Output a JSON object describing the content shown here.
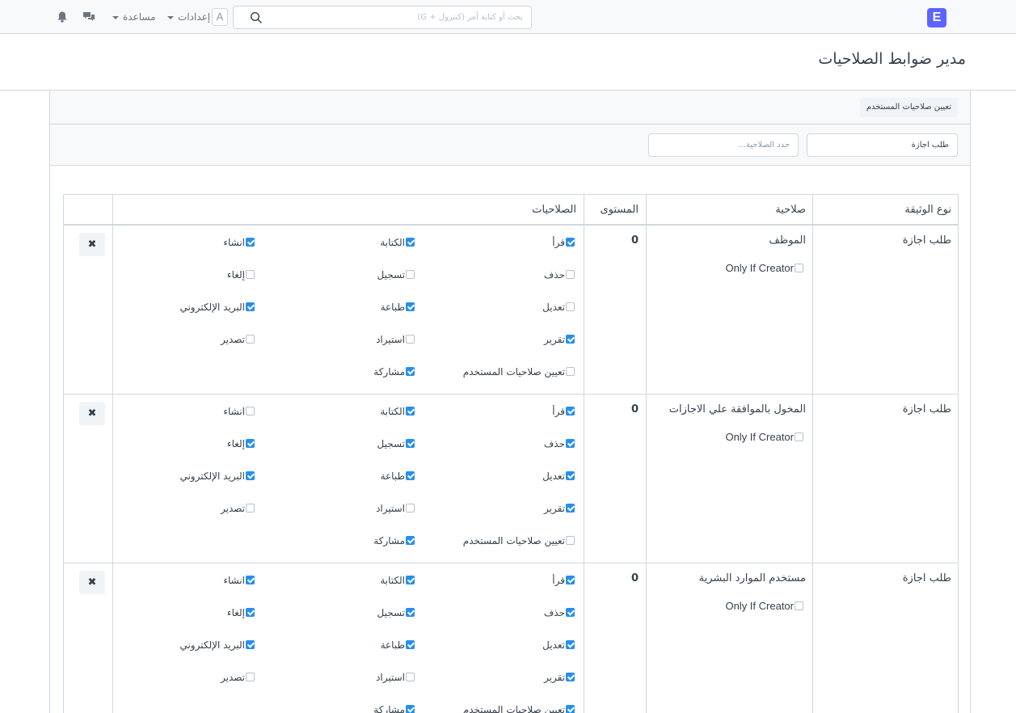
{
  "navbar": {
    "brand_letter": "E",
    "search_placeholder": "بحث أو كتابة أمر (كنترول + G)",
    "user_initial": "A",
    "settings_label": "إعدادات",
    "help_label": "مساعدة",
    "icons": [
      "search-icon",
      "chat-icon",
      "bell-icon"
    ]
  },
  "page": {
    "title": "مدير ضوابط الصلاحيات"
  },
  "toolbar": {
    "assign_button": "تعيين صلاحيات المستخدم"
  },
  "filters": {
    "doctype_value": "طلب اجازة",
    "role_placeholder": "حدد الصلاحية..."
  },
  "table": {
    "headers": {
      "doctype": "نوع الوثيقة",
      "role": "صلاحية",
      "level": "المستوى",
      "permissions": "الصلاحيات"
    },
    "rows": [
      {
        "doctype": "طلب اجازة",
        "role": "الموظف",
        "only_if_creator": "Only If Creator",
        "only_if_creator_checked": false,
        "level": "0",
        "perms": {
          "read": {
            "label": "قرأ",
            "checked": true
          },
          "write": {
            "label": "الكتابة",
            "checked": true
          },
          "create": {
            "label": "انشاء",
            "checked": true
          },
          "delete": {
            "label": "حذف",
            "checked": false
          },
          "submit": {
            "label": "تسجيل",
            "checked": false
          },
          "cancel": {
            "label": "إلغاء",
            "checked": false
          },
          "amend": {
            "label": "تعديل",
            "checked": false
          },
          "print": {
            "label": "طباعة",
            "checked": true
          },
          "email": {
            "label": "البريد الإلكتروني",
            "checked": true
          },
          "report": {
            "label": "تقرير",
            "checked": true
          },
          "import": {
            "label": "استيراد",
            "checked": false
          },
          "export": {
            "label": "تصدير",
            "checked": false
          },
          "set_user_permissions": {
            "label": "تعيين صلاحيات المستخدم",
            "checked": false
          },
          "share": {
            "label": "مشاركة",
            "checked": true
          }
        },
        "delete_glyph": "✖"
      },
      {
        "doctype": "طلب اجازة",
        "role": "المخول بالموافقة علي الاجازات",
        "only_if_creator": "Only If Creator",
        "only_if_creator_checked": false,
        "level": "0",
        "perms": {
          "read": {
            "label": "قرأ",
            "checked": true
          },
          "write": {
            "label": "الكتابة",
            "checked": true
          },
          "create": {
            "label": "انشاء",
            "checked": false
          },
          "delete": {
            "label": "حذف",
            "checked": true
          },
          "submit": {
            "label": "تسجيل",
            "checked": true
          },
          "cancel": {
            "label": "إلغاء",
            "checked": true
          },
          "amend": {
            "label": "تعديل",
            "checked": true
          },
          "print": {
            "label": "طباعة",
            "checked": true
          },
          "email": {
            "label": "البريد الإلكتروني",
            "checked": true
          },
          "report": {
            "label": "تقرير",
            "checked": true
          },
          "import": {
            "label": "استيراد",
            "checked": false
          },
          "export": {
            "label": "تصدير",
            "checked": false
          },
          "set_user_permissions": {
            "label": "تعيين صلاحيات المستخدم",
            "checked": false
          },
          "share": {
            "label": "مشاركة",
            "checked": true
          }
        },
        "delete_glyph": "✖"
      },
      {
        "doctype": "طلب اجازة",
        "role": "مستخدم الموارد البشرية",
        "only_if_creator": "Only If Creator",
        "only_if_creator_checked": false,
        "level": "0",
        "perms": {
          "read": {
            "label": "قرأ",
            "checked": true
          },
          "write": {
            "label": "الكتابة",
            "checked": true
          },
          "create": {
            "label": "انشاء",
            "checked": true
          },
          "delete": {
            "label": "حذف",
            "checked": true
          },
          "submit": {
            "label": "تسجيل",
            "checked": true
          },
          "cancel": {
            "label": "إلغاء",
            "checked": true
          },
          "amend": {
            "label": "تعديل",
            "checked": true
          },
          "print": {
            "label": "طباعة",
            "checked": true
          },
          "email": {
            "label": "البريد الإلكتروني",
            "checked": true
          },
          "report": {
            "label": "تقرير",
            "checked": true
          },
          "import": {
            "label": "استيراد",
            "checked": false
          },
          "export": {
            "label": "تصدير",
            "checked": false
          },
          "set_user_permissions": {
            "label": "تعيين صلاحيات المستخدم",
            "checked": true
          },
          "share": {
            "label": "مشاركة",
            "checked": true
          }
        },
        "delete_glyph": "✖"
      }
    ]
  },
  "colors": {
    "brand": "#5e64ff",
    "checkbox_on": "#2490ef",
    "border": "#d1d8dd"
  }
}
